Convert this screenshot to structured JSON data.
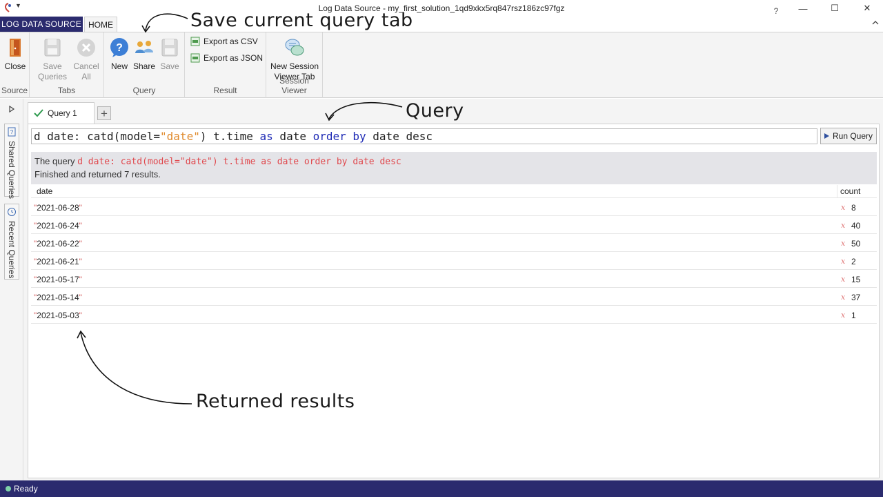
{
  "window": {
    "title": "Log Data Source - my_first_solution_1qd9xkx5rq847rsz186zc97fgz",
    "help": "?",
    "minimize": "—",
    "maximize": "☐",
    "close": "✕"
  },
  "ribbon_tabs": {
    "source": "LOG DATA SOURCE",
    "home": "HOME"
  },
  "ribbon": {
    "source_group": {
      "label": "Source",
      "close": "Close"
    },
    "tabs_group": {
      "label": "Tabs",
      "save_queries": "Save Queries",
      "cancel_all": "Cancel All"
    },
    "query_group": {
      "label": "Query",
      "new": "New",
      "share": "Share",
      "save": "Save"
    },
    "result_group": {
      "label": "Result",
      "export_csv": "Export as CSV",
      "export_json": "Export as JSON"
    },
    "session_group": {
      "label": "Session Viewer",
      "new_session": "New Session Viewer Tab"
    }
  },
  "side_tabs": {
    "shared": "Shared Queries",
    "recent": "Recent Queries"
  },
  "doc_tab": {
    "label": "Query 1"
  },
  "query": {
    "p1": "d date: catd(model=",
    "p2": "\"date\"",
    "p3": ") t.time ",
    "p4": "as",
    "p5": " date ",
    "p6": "order by",
    "p7": " date desc"
  },
  "run_button": "Run Query",
  "status": {
    "prefix": "The query ",
    "query_text": "d date: catd(model=\"date\") t.time as date order by date desc",
    "result_line": "Finished and returned 7 results."
  },
  "results": {
    "columns": [
      "date",
      "count"
    ],
    "rows": [
      {
        "date": "2021-06-28",
        "count": "8"
      },
      {
        "date": "2021-06-24",
        "count": "40"
      },
      {
        "date": "2021-06-22",
        "count": "50"
      },
      {
        "date": "2021-06-21",
        "count": "2"
      },
      {
        "date": "2021-05-17",
        "count": "15"
      },
      {
        "date": "2021-05-14",
        "count": "37"
      },
      {
        "date": "2021-05-03",
        "count": "1"
      }
    ]
  },
  "annotations": {
    "save_tab": "Save current query tab",
    "query": "Query",
    "results": "Returned results"
  },
  "statusbar": {
    "text": "Ready"
  },
  "colors": {
    "brand": "#2b2b6e",
    "keyword": "#1f2bb5",
    "string": "#e08a2c",
    "error_query": "#e0474c"
  }
}
